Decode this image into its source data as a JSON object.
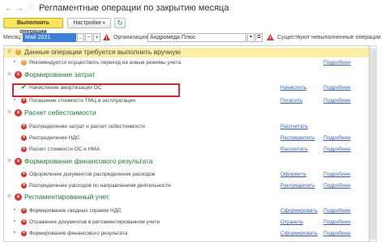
{
  "window": {
    "title": "Регламентные операции по закрытию месяца",
    "icons": [
      "back-arrow-icon",
      "forward-arrow-icon",
      "star-icon",
      "refresh-icon",
      "warning-icon"
    ]
  },
  "toolbar": {
    "run_label": "Выполнить операции",
    "settings_label": "Настройки",
    "settings_caret": "▾",
    "refresh_glyph": "↻"
  },
  "filters": {
    "month_label": "Месяц:",
    "month_value": "Май 2021",
    "month_buttons": [
      "...",
      "−",
      "+"
    ],
    "org_label": "Организация:",
    "org_value": "Андромеда Плюс",
    "org_buttons": [
      "▾",
      "⧉"
    ],
    "warning_text": "Существуют невыполненные операции"
  },
  "sections": [
    {
      "title": "Данные операции требуется выполнить вручную",
      "highlight": true,
      "items": [
        {
          "text": "Рекомендуется осуществить переход на новые режимы учета",
          "action": "",
          "detail": "Подробнее",
          "status": "warning"
        }
      ]
    },
    {
      "title": "Формирование затрат",
      "items": [
        {
          "text": "Начисление амортизации ОС",
          "action": "Начислить",
          "detail": "Подробнее",
          "status": "done"
        },
        {
          "text": "Погашение стоимости ТМЦ в эксплуатации",
          "action": "Погасить",
          "detail": "Подробнее",
          "status": "error"
        }
      ]
    },
    {
      "title": "Расчет себестоимости",
      "items": [
        {
          "text": "Распределение затрат и расчет себестоимости",
          "action": "Рассчитать",
          "detail": "",
          "status": "error"
        },
        {
          "text": "Распределение НДС",
          "action": "Распределить",
          "detail": "Подробнее",
          "status": "error"
        },
        {
          "text": "Расчет стоимости ОС и НМА",
          "action": "Рассчитать",
          "detail": "Подробнее",
          "status": "error"
        }
      ]
    },
    {
      "title": "Формирование финансового результата",
      "items": [
        {
          "text": "Оформление документов распределения расходов",
          "action": "Оформить",
          "detail": "Подробнее",
          "status": "error"
        },
        {
          "text": "Распределение расходов по направлениям деятельности",
          "action": "Распределить",
          "detail": "Подробнее",
          "status": "error"
        }
      ]
    },
    {
      "title": "Регламентированный учет",
      "items": [
        {
          "text": "Формирование сводных справок НДС",
          "action": "Сформировать",
          "detail": "Подробнее",
          "status": "error"
        },
        {
          "text": "Отражение документов в регламентированном учете",
          "action": "Отразить",
          "detail": "Подробнее",
          "status": "error"
        },
        {
          "text": "Формирование финансового результата",
          "action": "Сформировать",
          "detail": "Подробнее",
          "status": "error"
        }
      ]
    }
  ],
  "glyphs": {
    "collapse": "⊖",
    "warning": "!",
    "error": "×",
    "done": "✔"
  },
  "colors": {
    "accent_yellow": "#fbe35c",
    "error_red": "#d9332b",
    "ok_green": "#2ea043",
    "link_blue": "#3b5fae",
    "section_green": "#1f7a3a",
    "highlight_row": "#fbeea5"
  }
}
